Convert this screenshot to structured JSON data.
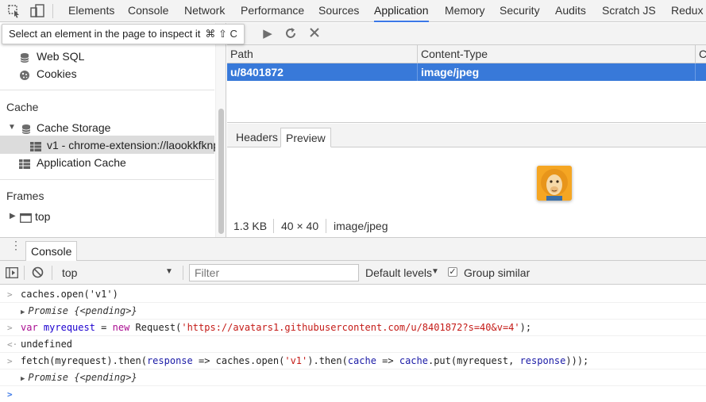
{
  "tabs": [
    "Elements",
    "Console",
    "Network",
    "Performance",
    "Sources",
    "Application",
    "Memory",
    "Security",
    "Audits",
    "Scratch JS",
    "Redux"
  ],
  "active_tab": "Application",
  "tooltip": {
    "text": "Select an element in the page to inspect it",
    "shortcut": "⌘ ⇧ C"
  },
  "sidebar": {
    "storage_items": [
      {
        "label": "Web SQL",
        "icon": "database-icon"
      },
      {
        "label": "Cookies",
        "icon": "cookie-icon"
      }
    ],
    "cache_section": "Cache",
    "cache_storage": "Cache Storage",
    "cache_entry": "v1 - chrome-extension://laookkfknp",
    "application_cache": "Application Cache",
    "frames_section": "Frames",
    "frame_top": "top"
  },
  "table": {
    "columns": [
      "Path",
      "Content-Type",
      "C"
    ],
    "rows": [
      {
        "path": "u/8401872",
        "content_type": "image/jpeg"
      }
    ]
  },
  "preview": {
    "tabs": [
      "Headers",
      "Preview"
    ],
    "active_tab": "Preview",
    "size": "1.3 KB",
    "dimensions": "40 × 40",
    "mime": "image/jpeg"
  },
  "drawer": {
    "tab": "Console",
    "context": "top",
    "filter_placeholder": "Filter",
    "levels": "Default levels",
    "group_similar": "Group similar",
    "group_similar_checked": true
  },
  "console": {
    "line1": "caches.open('v1')",
    "line2": "Promise {<pending>}",
    "line3_var": "var",
    "line3_name": "myrequest",
    "line3_eq": " = ",
    "line3_new": "new",
    "line3_call": " Request(",
    "line3_url": "'https://avatars1.githubusercontent.com/u/8401872?s=40&v=4'",
    "line3_end": ");",
    "line4": "undefined",
    "line5_a": "fetch(myrequest).then(",
    "line5_b": "response",
    "line5_c": " => caches.open(",
    "line5_d": "'v1'",
    "line5_e": ").then(",
    "line5_f": "cache",
    "line5_g": " => ",
    "line5_h": "cache",
    "line5_i": ".put(myrequest, ",
    "line5_j": "response",
    "line5_k": ")));",
    "line6": "Promise {<pending>}"
  },
  "colors": {
    "selection_blue": "#3879d9",
    "active_tab_underline": "#3b78e7",
    "prompt_blue": "#3b78e7"
  }
}
